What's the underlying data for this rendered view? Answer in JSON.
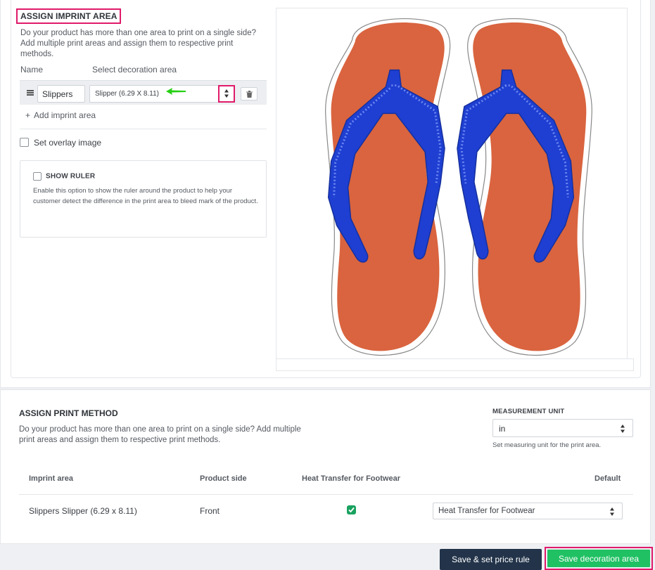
{
  "imprint": {
    "title": "ASSIGN IMPRINT AREA",
    "intro": "Do your product has more than one area to print on a single side? Add multiple print areas and assign them to respective print methods.",
    "col_name": "Name",
    "col_decoration": "Select decoration area",
    "row": {
      "name_value": "Slippers",
      "decoration_value": "Slipper (6.29 X 8.11)"
    },
    "add_label": "Add imprint area",
    "overlay_label": "Set overlay image",
    "ruler": {
      "title": "SHOW RULER",
      "desc": "Enable this option to show the ruler around the product to help your customer detect the difference in the print area to bleed mark of the product."
    }
  },
  "print_method": {
    "title": "ASSIGN PRINT METHOD",
    "desc": "Do your product has more than one area to print on a single side? Add multiple print areas and assign them to respective print methods.",
    "measurement": {
      "label": "MEASUREMENT UNIT",
      "value": "in",
      "help": "Set measuring unit for the print area."
    },
    "headers": {
      "imprint_area": "Imprint area",
      "product_side": "Product side",
      "method": "Heat Transfer for Footwear",
      "default": "Default"
    },
    "row": {
      "imprint_area": "Slippers Slipper (6.29 x 8.11)",
      "product_side": "Front",
      "method_checked": true,
      "default_value": "Heat Transfer for Footwear"
    }
  },
  "actions": {
    "save_price": "Save & set price rule",
    "save_area": "Save decoration area"
  },
  "colors": {
    "highlight": "#e01a6a",
    "sole": "#d9643f",
    "strap": "#1e3fd1",
    "green": "#20c163",
    "dark": "#23344a"
  }
}
